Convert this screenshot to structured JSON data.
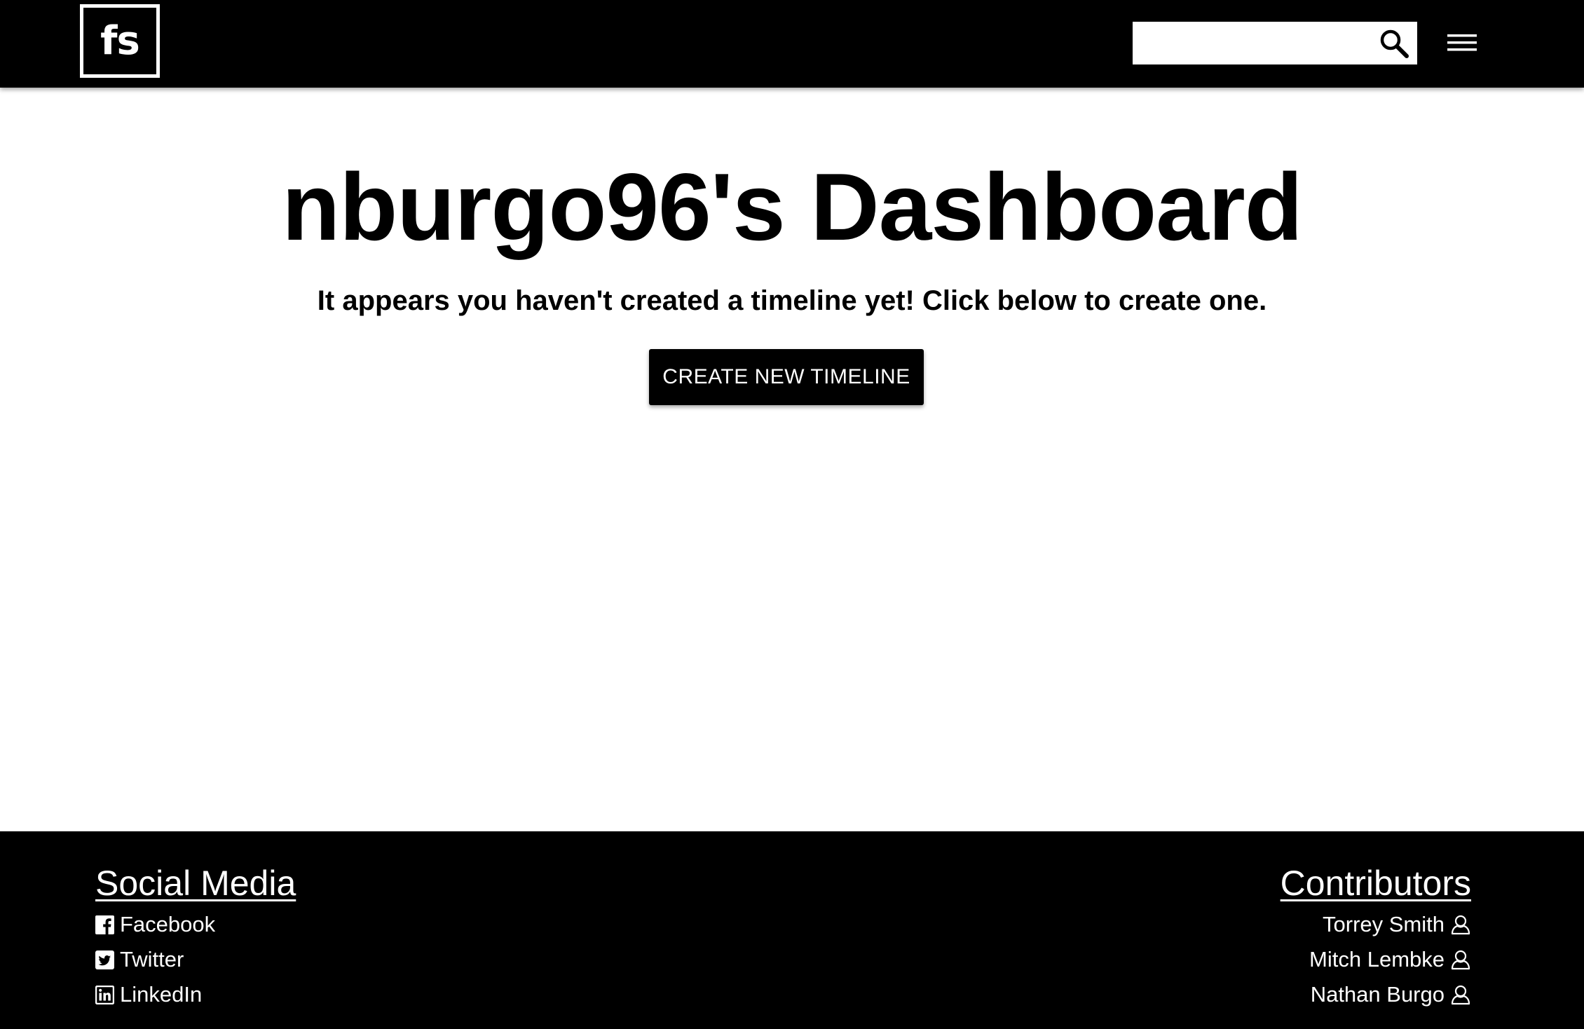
{
  "header": {
    "logo_text": "fs",
    "search": {
      "value": "",
      "placeholder": ""
    },
    "search_icon": "magnifier-icon",
    "menu_icon": "hamburger-menu-icon"
  },
  "main": {
    "title": "nburgo96's Dashboard",
    "subtitle": "It appears you haven't created a timeline yet! Click below to create one.",
    "create_button_label": "CREATE NEW TIMELINE"
  },
  "footer": {
    "social": {
      "heading": "Social Media",
      "links": [
        {
          "label": "Facebook",
          "icon": "facebook-icon"
        },
        {
          "label": "Twitter",
          "icon": "twitter-icon"
        },
        {
          "label": "LinkedIn",
          "icon": "linkedin-icon"
        }
      ]
    },
    "contributors": {
      "heading": "Contributors",
      "people": [
        {
          "name": "Torrey Smith",
          "icon": "user-icon"
        },
        {
          "name": "Mitch Lembke",
          "icon": "user-icon"
        },
        {
          "name": "Nathan Burgo",
          "icon": "user-icon"
        }
      ]
    }
  },
  "colors": {
    "header_bg": "#000000",
    "footer_bg": "#000000",
    "page_bg": "#ffffff",
    "button_bg": "#000000",
    "button_text": "#ffffff"
  }
}
